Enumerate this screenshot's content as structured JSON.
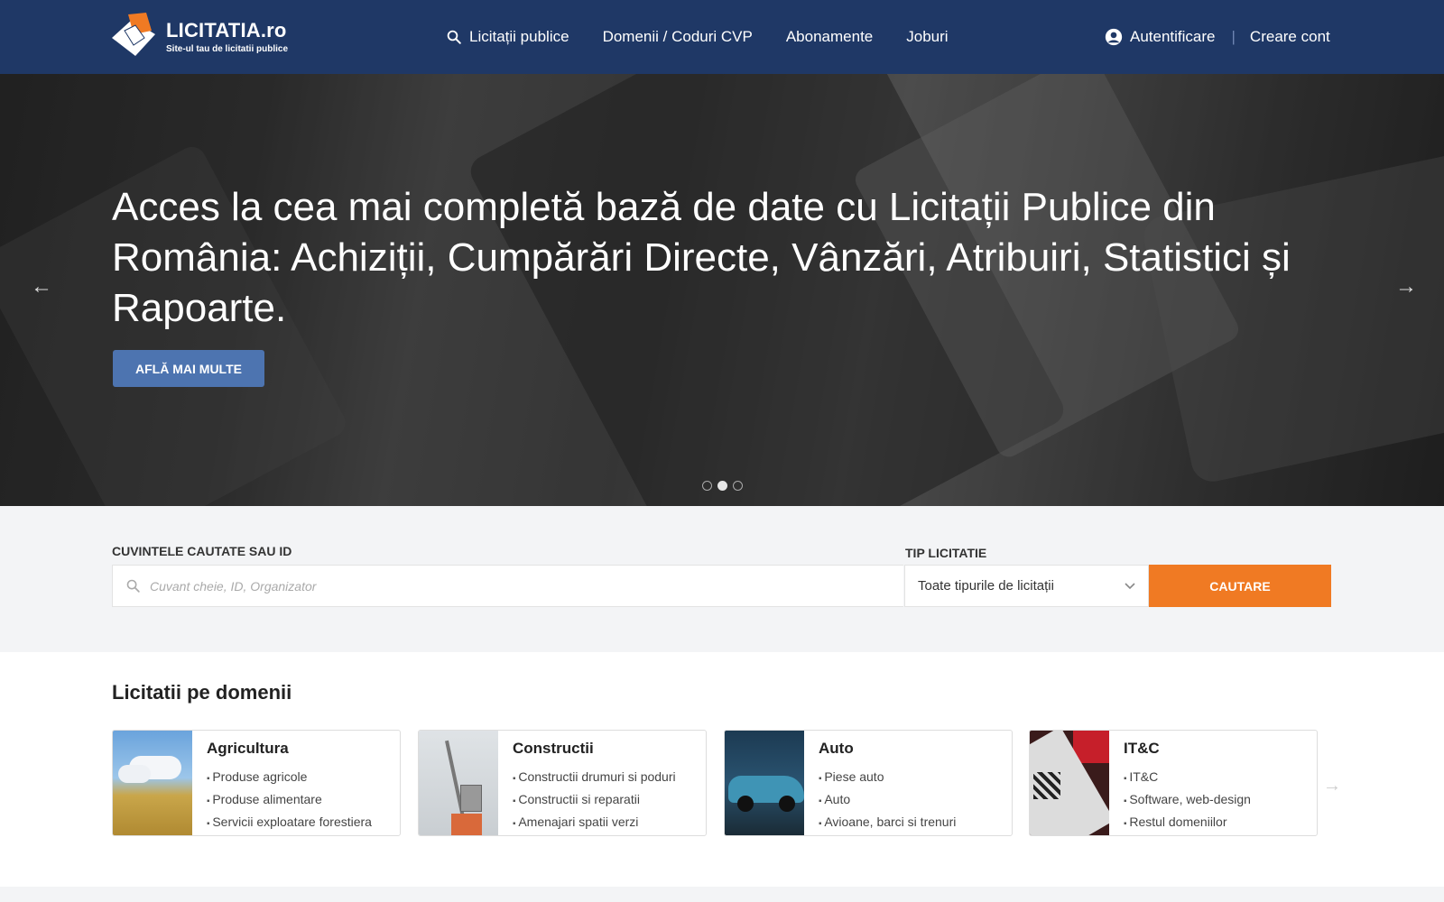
{
  "header": {
    "logo_title": "LICITATIA.ro",
    "logo_subtitle": "Site-ul tau de licitatii publice",
    "nav": [
      {
        "label": "Licitații publice",
        "icon": "search-icon"
      },
      {
        "label": "Domenii / Coduri CVP"
      },
      {
        "label": "Abonamente"
      },
      {
        "label": "Joburi"
      }
    ],
    "login_label": "Autentificare",
    "separator": "|",
    "register_label": "Creare cont"
  },
  "hero": {
    "title": "Acces la cea mai completă bază de date cu Licitații Publice din România: Achiziții, Cumpărări Directe, Vânzări, Atribuiri, Statistici și Rapoarte.",
    "button_label": "AFLĂ MAI MULTE",
    "prev_arrow": "←",
    "next_arrow": "→",
    "slides_count": 3,
    "active_slide": 2
  },
  "search": {
    "keywords_label": "CUVINTELE CAUTATE SAU ID",
    "keywords_placeholder": "Cuvant cheie, ID, Organizator",
    "type_label": "TIP LICITATIE",
    "type_selected": "Toate tipurile de licitații",
    "button_label": "CAUTARE"
  },
  "domains": {
    "title": "Licitatii pe domenii",
    "next_arrow": "→",
    "cards": [
      {
        "title": "Agricultura",
        "items": [
          "Produse agricole",
          "Produse alimentare",
          "Servicii exploatare forestiera"
        ]
      },
      {
        "title": "Constructii",
        "items": [
          "Constructii drumuri si poduri",
          "Constructii si reparatii",
          "Amenajari spatii verzi"
        ]
      },
      {
        "title": "Auto",
        "items": [
          "Piese auto",
          "Auto",
          "Avioane, barci si trenuri"
        ]
      },
      {
        "title": "IT&C",
        "items": [
          "IT&C",
          "Software, web-design",
          "Restul domeniilor"
        ]
      }
    ]
  },
  "colors": {
    "header_bg": "#1f3866",
    "accent_orange": "#f07a23",
    "hero_button": "#4d74b0"
  }
}
